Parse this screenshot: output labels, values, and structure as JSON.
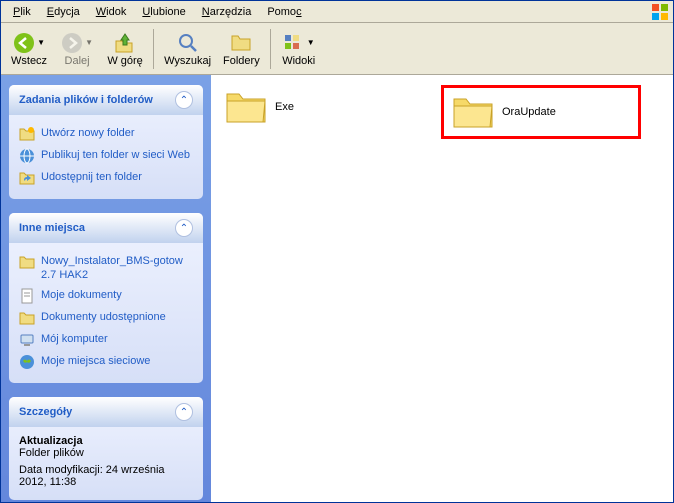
{
  "menu": {
    "items": [
      {
        "pre": "",
        "u": "P",
        "post": "lik"
      },
      {
        "pre": "",
        "u": "E",
        "post": "dycja"
      },
      {
        "pre": "",
        "u": "W",
        "post": "idok"
      },
      {
        "pre": "",
        "u": "U",
        "post": "lubione"
      },
      {
        "pre": "",
        "u": "N",
        "post": "arzędzia"
      },
      {
        "pre": "Pomo",
        "u": "c",
        "post": ""
      }
    ]
  },
  "toolbar": {
    "back": "Wstecz",
    "forward": "Dalej",
    "up": "W górę",
    "search": "Wyszukaj",
    "folders": "Foldery",
    "views": "Widoki"
  },
  "sidebar": {
    "panel1": {
      "title": "Zadania plików i folderów",
      "items": [
        {
          "icon": "folder-new",
          "label": "Utwórz nowy folder"
        },
        {
          "icon": "publish",
          "label": "Publikuj ten folder w sieci Web"
        },
        {
          "icon": "share",
          "label": "Udostępnij ten folder"
        }
      ]
    },
    "panel2": {
      "title": "Inne miejsca",
      "items": [
        {
          "icon": "folder",
          "label": "Nowy_Instalator_BMS-gotow 2.7 HAK2"
        },
        {
          "icon": "docs",
          "label": "Moje dokumenty"
        },
        {
          "icon": "shared",
          "label": "Dokumenty udostępnione"
        },
        {
          "icon": "computer",
          "label": "Mój komputer"
        },
        {
          "icon": "network",
          "label": "Moje miejsca sieciowe"
        }
      ]
    },
    "panel3": {
      "title": "Szczegóły",
      "name": "Aktualizacja",
      "type": "Folder plików",
      "modified": "Data modyfikacji: 24 września 2012, 11:38"
    }
  },
  "folders": {
    "items": [
      {
        "name": "Exe",
        "highlighted": false
      },
      {
        "name": "OraUpdate",
        "highlighted": true
      }
    ]
  }
}
